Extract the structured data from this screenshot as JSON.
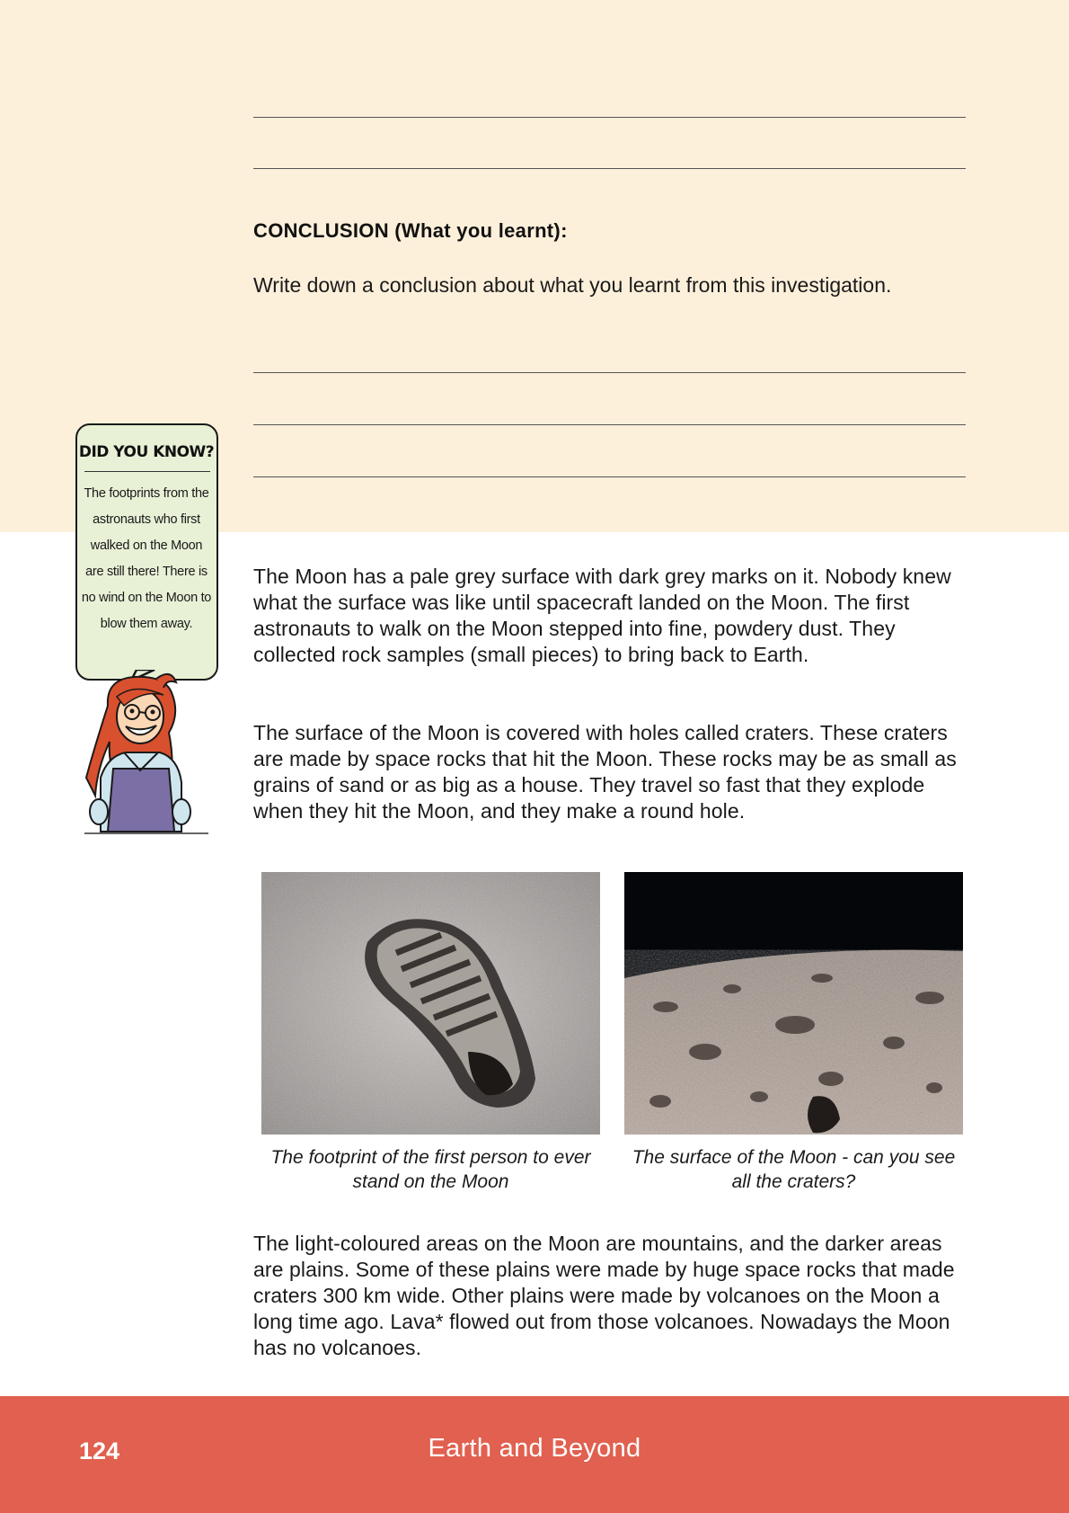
{
  "conclusion": {
    "heading": "CONCLUSION (What you learnt):",
    "instruction": "Write down a conclusion about what you learnt from this investigation."
  },
  "did_you_know": {
    "title": "DID YOU KNOW?",
    "body": "The footprints from the astronauts who first walked on the Moon are still there! There is no wind on the Moon to blow them away."
  },
  "paragraphs": [
    "The Moon has a pale grey surface with dark grey marks on it. Nobody knew what the surface was like until spacecraft landed on the Moon. The first astronauts to walk on the Moon stepped into fine, powdery dust. They collected rock samples (small pieces) to bring back to Earth.",
    "The surface of the Moon is covered with holes called craters. These craters are made by space rocks that hit the Moon. These rocks may be as small as grains of sand or as big as a house. They travel so fast that they explode when they hit the Moon, and they make a round hole.",
    "The light-coloured areas on the Moon are mountains, and the darker areas are plains. Some of these plains were made by huge space rocks that made craters 300 km wide. Other plains were made by volcanoes on the Moon a long time ago. Lava* flowed out from those volcanoes. Nowadays the Moon has no volcanoes."
  ],
  "images": [
    {
      "icon": "footprint-photo",
      "caption": "The footprint of the first person to ever stand on the Moon"
    },
    {
      "icon": "moon-surface-photo",
      "caption": "The surface of the Moon - can you see all the craters?"
    }
  ],
  "footer": {
    "page_number": "124",
    "title": "Earth and Beyond"
  },
  "colors": {
    "top_band": "#fdf0da",
    "did_you_know_fill": "#e8f1d6",
    "footer": "#e1604f"
  }
}
